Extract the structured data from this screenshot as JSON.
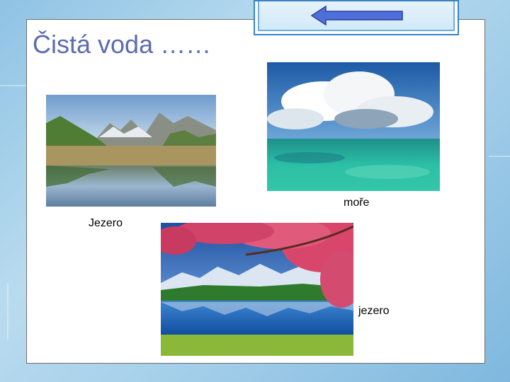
{
  "slide": {
    "title": "Čistá voda ……"
  },
  "navigation": {
    "back_icon": "left-arrow-icon"
  },
  "photos": [
    {
      "caption": "Jezero",
      "subject": "mountain-lake-reeds"
    },
    {
      "caption": "moře",
      "subject": "sea-clouds"
    },
    {
      "caption": "jezero",
      "subject": "lake-cherry-blossom"
    }
  ],
  "colors": {
    "title": "#5b6cb0",
    "arrow_fill": "#4f6fd8",
    "nav_border": "#3a84c6"
  }
}
